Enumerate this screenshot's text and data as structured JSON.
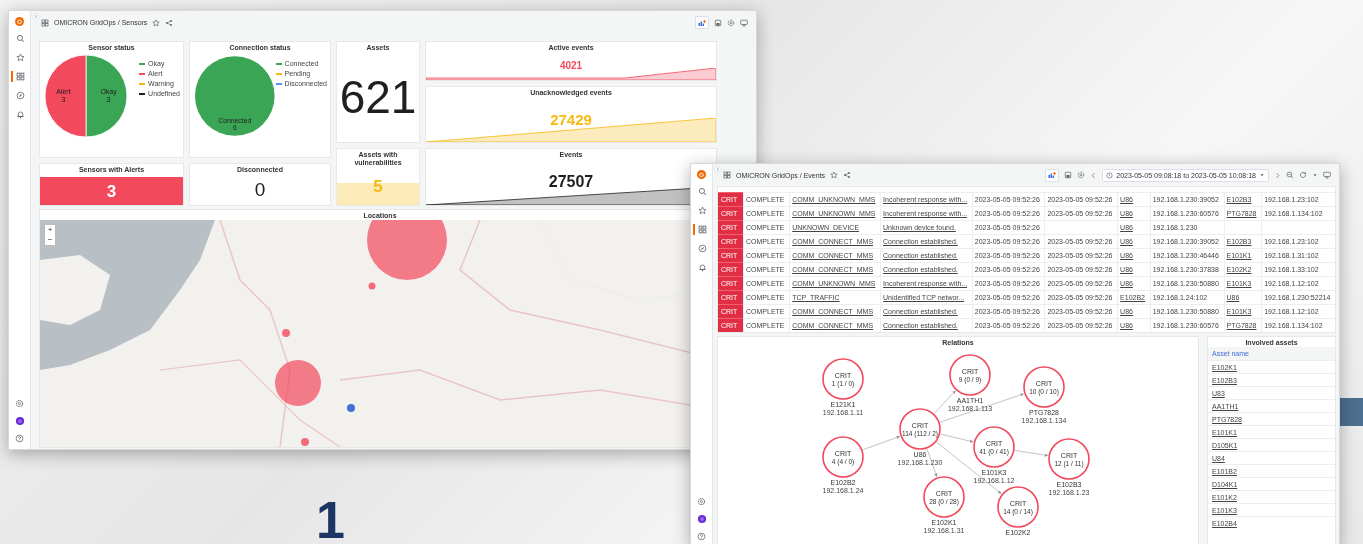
{
  "background": {
    "step_number": "1"
  },
  "sensors_window": {
    "sidebar": {
      "nav": [
        {
          "selected": false
        },
        {
          "selected": false
        },
        {
          "selected": true
        },
        {
          "selected": false
        },
        {
          "selected": false
        }
      ]
    },
    "breadcrumb": "OMICRON GridOps / Sensors",
    "panels": [
      {
        "kind": "pie",
        "title": "Sensor status",
        "legend": [
          {
            "label": "Okay",
            "color": "#3aa655"
          },
          {
            "label": "Alert",
            "color": "#f2495c"
          },
          {
            "label": "Warning",
            "color": "#f5b911"
          },
          {
            "label": "Undefined",
            "color": "#1f1f1f"
          }
        ],
        "chart_data": {
          "type": "pie",
          "categories": [
            "Okay",
            "Alert"
          ],
          "values": [
            3,
            3
          ],
          "data_labels": true
        }
      },
      {
        "kind": "pie",
        "title": "Connection status",
        "legend": [
          {
            "label": "Connected",
            "color": "#3aa655"
          },
          {
            "label": "Pending",
            "color": "#f5b911"
          },
          {
            "label": "Disconnected",
            "color": "#5794f2"
          }
        ],
        "chart_data": {
          "type": "pie",
          "categories": [
            "Connected"
          ],
          "values": [
            6
          ],
          "data_labels": true
        }
      },
      {
        "kind": "stat",
        "title": "Assets",
        "value": "621",
        "color": "#1f1f1f"
      },
      {
        "kind": "sparkline",
        "title": "Active events",
        "value": "4021",
        "color": "#f2495c"
      },
      {
        "kind": "sparkline",
        "title": "Unacknowledged events",
        "value": "27429",
        "color": "#f5b911"
      },
      {
        "kind": "filled",
        "title": "Sensors with Alerts",
        "value": "3",
        "color": "#f2495c"
      },
      {
        "kind": "stat",
        "title": "Disconnected",
        "value": "0",
        "color": "#1f1f1f"
      },
      {
        "kind": "band",
        "title": "Assets with vulnerabilities",
        "value": "5",
        "color": "#f5b911"
      },
      {
        "kind": "sparkline",
        "title": "Events",
        "value": "27507",
        "color": "#1f1f1f"
      }
    ],
    "map": {
      "title": "Locations",
      "zoom_in": "+",
      "zoom_out": "−",
      "kind": "picture"
    }
  },
  "events_window": {
    "sidebar": {
      "nav": [
        {
          "selected": false
        },
        {
          "selected": false
        },
        {
          "selected": true
        },
        {
          "selected": false
        },
        {
          "selected": false
        }
      ]
    },
    "breadcrumb": "OMICRON GridOps / Events",
    "time_range": "2023-05-05 09:08:18 to 2023-05-05 10:08:18",
    "table": {
      "rows": [
        {
          "severity": "CRIT",
          "state": "COMPLETE",
          "type": "COMM_UNKNOWN_MMS",
          "message": "Incoherent response with...",
          "start": "2023-05-05 09:52:26",
          "end": "2023-05-05 09:52:26",
          "source": "U86",
          "source_ip": "192.168.1.230:39052",
          "target": "E102B3",
          "target_ip": "192.168.1.23:102"
        },
        {
          "severity": "CRIT",
          "state": "COMPLETE",
          "type": "COMM_UNKNOWN_MMS",
          "message": "Incoherent response with...",
          "start": "2023-05-05 09:52:26",
          "end": "2023-05-05 09:52:26",
          "source": "U86",
          "source_ip": "192.168.1.230:60576",
          "target": "PTG7828",
          "target_ip": "192.168.1.134:102"
        },
        {
          "severity": "CRIT",
          "state": "COMPLETE",
          "type": "UNKNOWN_DEVICE",
          "message": "Unknown device found.",
          "start": "2023-05-05 09:52:26",
          "source": "U86",
          "source_ip": "192.168.1.230"
        },
        {
          "severity": "CRIT",
          "state": "COMPLETE",
          "type": "COMM_CONNECT_MMS",
          "message": "Connection established.",
          "start": "2023-05-05 09:52:26",
          "end": "2023-05-05 09:52:26",
          "source": "U86",
          "source_ip": "192.168.1.230:39052",
          "target": "E102B3",
          "target_ip": "192.168.1.23:102"
        },
        {
          "severity": "CRIT",
          "state": "COMPLETE",
          "type": "COMM_CONNECT_MMS",
          "message": "Connection established.",
          "start": "2023-05-05 09:52:26",
          "end": "2023-05-05 09:52:26",
          "source": "U86",
          "source_ip": "192.168.1.230:46446",
          "target": "E101K1",
          "target_ip": "192.168.1.31:102"
        },
        {
          "severity": "CRIT",
          "state": "COMPLETE",
          "type": "COMM_CONNECT_MMS",
          "message": "Connection established.",
          "start": "2023-05-05 09:52:26",
          "end": "2023-05-05 09:52:26",
          "source": "U86",
          "source_ip": "192.168.1.230:37838",
          "target": "E102K2",
          "target_ip": "192.168.1.33:102"
        },
        {
          "severity": "CRIT",
          "state": "COMPLETE",
          "type": "COMM_UNKNOWN_MMS",
          "message": "Incoherent response with...",
          "start": "2023-05-05 09:52:26",
          "end": "2023-05-05 09:52:26",
          "source": "U86",
          "source_ip": "192.168.1.230:50880",
          "target": "E101K3",
          "target_ip": "192.168.1.12:102"
        },
        {
          "severity": "CRIT",
          "state": "COMPLETE",
          "type": "TCP_TRAFFIC",
          "message": "Unidentified TCP networ...",
          "start": "2023-05-05 09:52:26",
          "end": "2023-05-05 09:52:26",
          "source": "E102B2",
          "source_ip": "192.168.1.24:102",
          "target": "U86",
          "target_ip": "192.168.1.230:52214"
        },
        {
          "severity": "CRIT",
          "state": "COMPLETE",
          "type": "COMM_CONNECT_MMS",
          "message": "Connection established.",
          "start": "2023-05-05 09:52:26",
          "end": "2023-05-05 09:52:26",
          "source": "U86",
          "source_ip": "192.168.1.230:50880",
          "target": "E101K3",
          "target_ip": "192.168.1.12:102"
        },
        {
          "severity": "CRIT",
          "state": "COMPLETE",
          "type": "COMM_CONNECT_MMS",
          "message": "Connection established.",
          "start": "2023-05-05 09:52:26",
          "end": "2023-05-05 09:52:26",
          "source": "U86",
          "source_ip": "192.168.1.230:60576",
          "target": "PTG7828",
          "target_ip": "192.168.1.134:102"
        }
      ]
    },
    "relations": {
      "title": "Relations",
      "nodes": [
        {
          "severity": "CRIT",
          "count": "1 (1 / 0)",
          "name": "E121K1",
          "ip": "192.168.1.11"
        },
        {
          "severity": "CRIT",
          "count": "4 (4 / 0)",
          "name": "E102B2",
          "ip": "192.168.1.24",
          "children": [
            {
              "severity": "CRIT",
              "count": "114 (112 / 2)",
              "name": "U86",
              "ip": "192.168.1.230",
              "children": [
                {
                  "severity": "CRIT",
                  "count": "9 (0 / 9)",
                  "name": "AA1TH1",
                  "ip": "192.168.1.113"
                },
                {
                  "severity": "CRIT",
                  "count": "10 (0 / 10)",
                  "name": "PTG7828",
                  "ip": "192.168.1.134"
                },
                {
                  "severity": "CRIT",
                  "count": "41 (0 / 41)",
                  "name": "E101K3",
                  "ip": "192.168.1.12",
                  "children": [
                    {
                      "severity": "CRIT",
                      "count": "12 (1 / 11)",
                      "name": "E102B3",
                      "ip": "192.168.1.23"
                    }
                  ]
                },
                {
                  "severity": "CRIT",
                  "count": "28 (0 / 28)",
                  "name": "E102K1",
                  "ip": "192.168.1.31"
                },
                {
                  "severity": "CRIT",
                  "count": "14 (0 / 14)",
                  "name": "E102K2"
                }
              ]
            }
          ]
        }
      ]
    },
    "involved_assets": {
      "title": "Involved assets",
      "column": "Asset name",
      "rows": [
        "E102K1",
        "E102B3",
        "U83",
        "AA1TH1",
        "PTG7828",
        "E101K1",
        "D105K1",
        "U84",
        "E101B2",
        "D104K1",
        "E101K2",
        "E101K3",
        "E102B4"
      ]
    }
  }
}
